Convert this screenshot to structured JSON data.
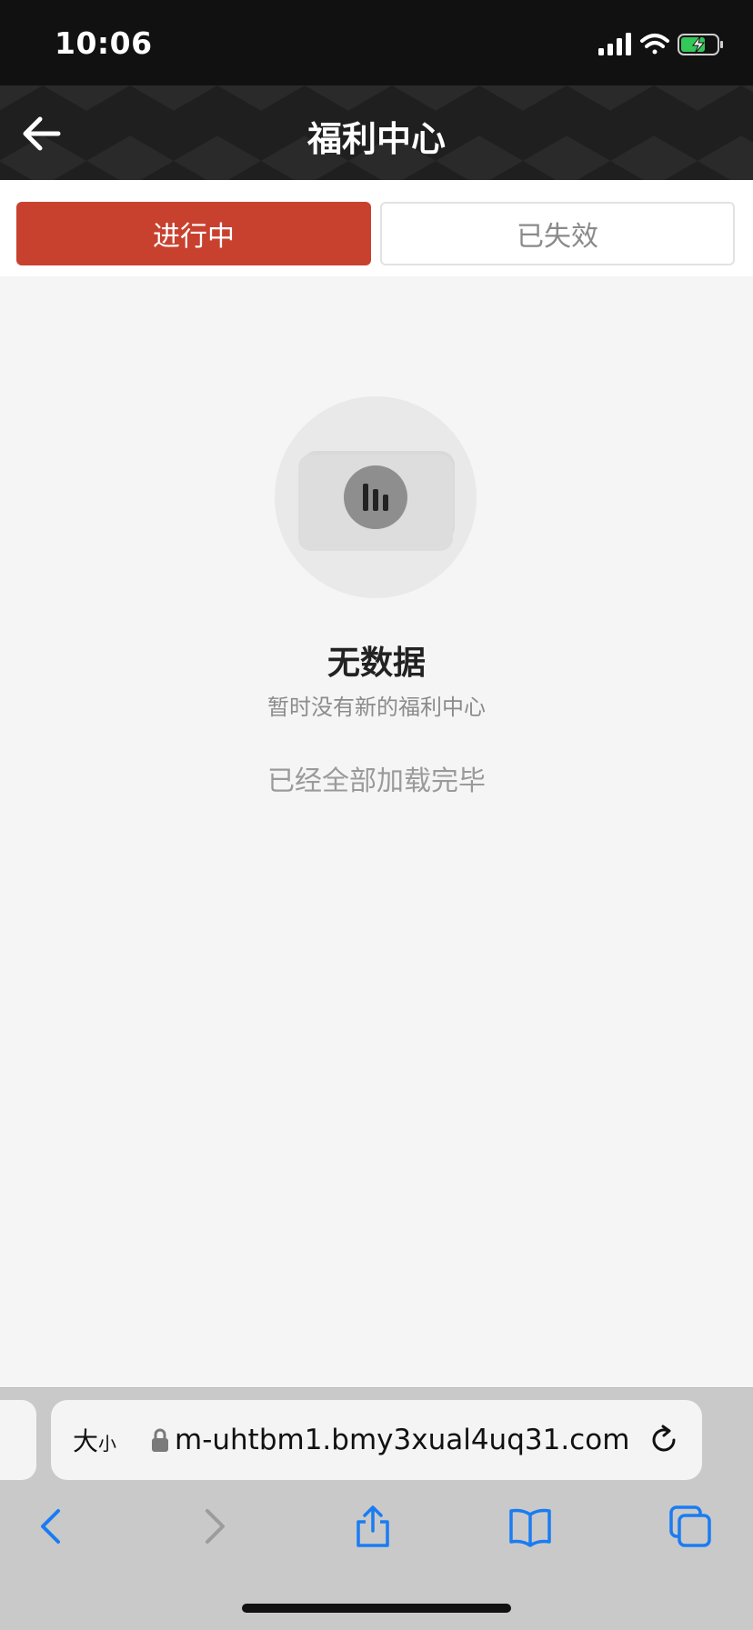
{
  "status_bar": {
    "time": "10:06"
  },
  "header": {
    "title": "福利中心"
  },
  "tabs": [
    {
      "label": "进行中",
      "active": true
    },
    {
      "label": "已失效",
      "active": false
    }
  ],
  "empty_state": {
    "title": "无数据",
    "description": "暂时没有新的福利中心"
  },
  "load_status": "已经全部加载完毕",
  "browser": {
    "text_size_large": "大",
    "text_size_small": "小",
    "url": "m-uhtbm1.bmy3xual4uq31.com"
  },
  "colors": {
    "accent": "#c8412f",
    "ios_blue": "#1a7cf2",
    "battery_green": "#34c759"
  },
  "icons": {
    "back": "arrow-left-icon",
    "signal": "cellular-signal-icon",
    "wifi": "wifi-icon",
    "battery": "battery-charging-icon",
    "lock": "lock-icon",
    "reload": "reload-icon",
    "browser_back": "chevron-left-icon",
    "browser_forward": "chevron-right-icon",
    "share": "share-icon",
    "bookmarks": "book-icon",
    "tabs": "tabs-icon"
  }
}
